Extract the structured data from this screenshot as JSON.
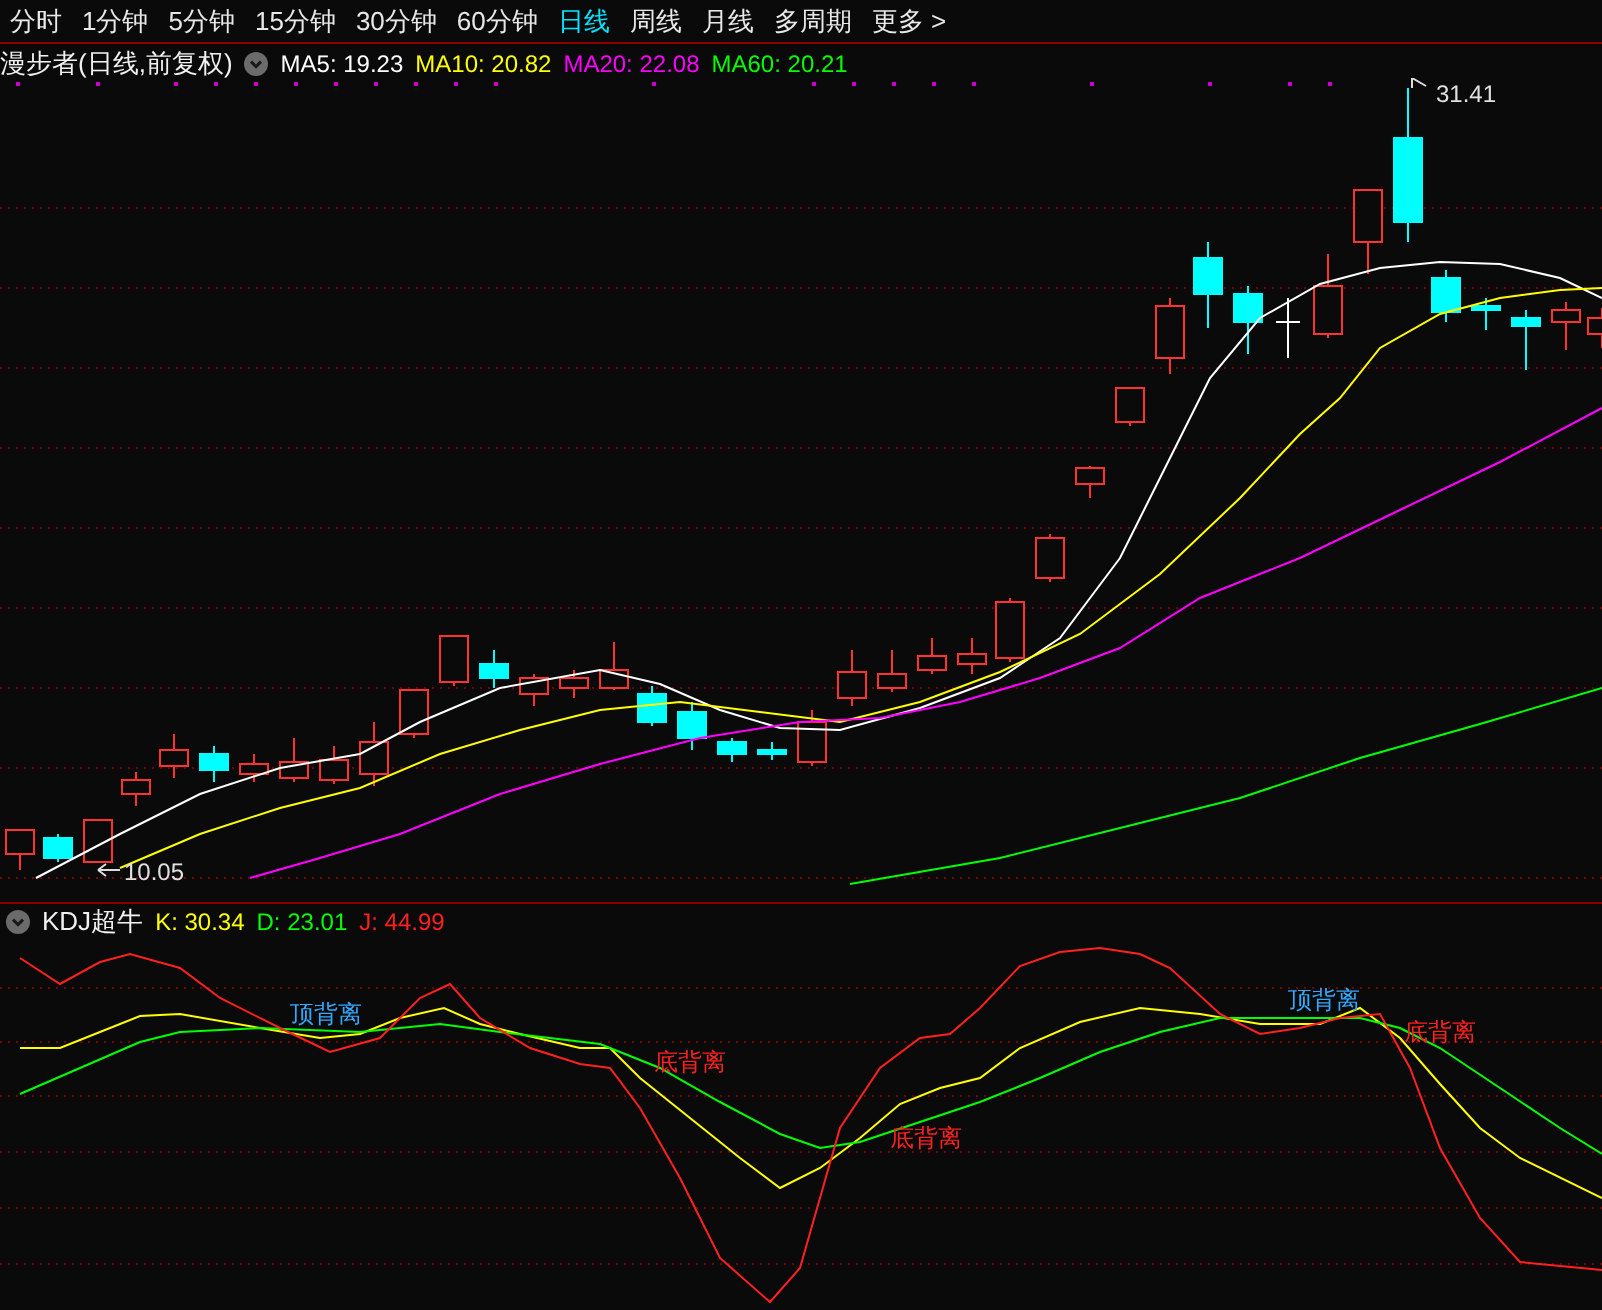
{
  "periods": [
    {
      "label": "分时",
      "selected": false
    },
    {
      "label": "1分钟",
      "selected": false
    },
    {
      "label": "5分钟",
      "selected": false
    },
    {
      "label": "15分钟",
      "selected": false
    },
    {
      "label": "30分钟",
      "selected": false
    },
    {
      "label": "60分钟",
      "selected": false
    },
    {
      "label": "日线",
      "selected": true
    },
    {
      "label": "周线",
      "selected": false
    },
    {
      "label": "月线",
      "selected": false
    },
    {
      "label": "多周期",
      "selected": false
    },
    {
      "label": "更多 >",
      "selected": false
    }
  ],
  "main_chart": {
    "title": "漫步者(日线,前复权)",
    "indicators": [
      {
        "label": "MA5: 19.23",
        "color": "#ffffff"
      },
      {
        "label": "MA10: 20.82",
        "color": "#ffff00"
      },
      {
        "label": "MA20: 22.08",
        "color": "#ff00ff"
      },
      {
        "label": "MA60: 20.21",
        "color": "#00ff00"
      }
    ],
    "high_label": "31.41",
    "low_label": "10.05"
  },
  "kdj_panel": {
    "title": "KDJ超牛",
    "indicators": [
      {
        "label": "K: 30.34",
        "color": "#ffff00"
      },
      {
        "label": "D: 23.01",
        "color": "#00ff00"
      },
      {
        "label": "J: 44.99",
        "color": "#ff2020"
      }
    ],
    "signals": [
      {
        "text": "顶背离",
        "color": "#33aaff"
      },
      {
        "text": "底背离",
        "color": "#ff2020"
      },
      {
        "text": "底背离",
        "color": "#ff2020"
      },
      {
        "text": "顶背离",
        "color": "#33aaff"
      },
      {
        "text": "底背离",
        "color": "#ff2020"
      }
    ]
  }
}
